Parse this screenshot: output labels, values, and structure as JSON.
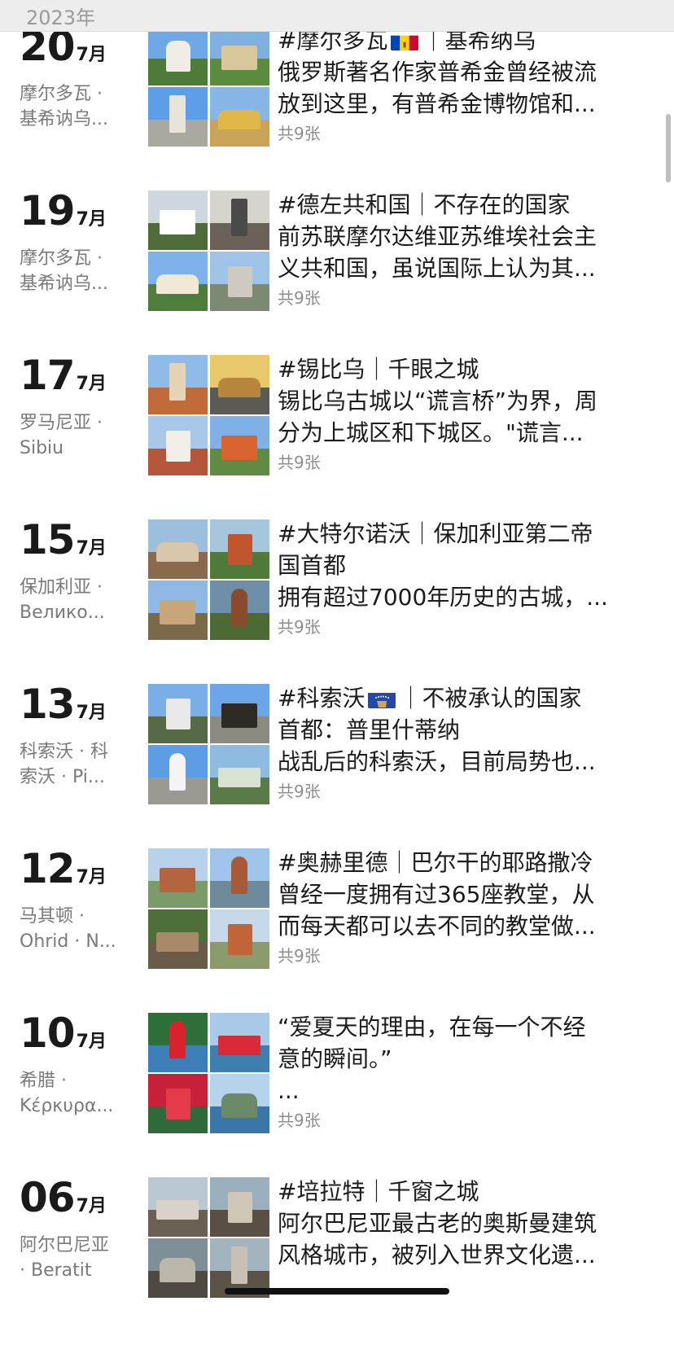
{
  "header": {
    "year": "2023年"
  },
  "entries": [
    {
      "day": "20",
      "month": "7月",
      "loc1": "摩尔多瓦 ·",
      "loc2": "基希讷乌...",
      "title": "#摩尔多瓦",
      "flag": "moldova",
      "title_after": "｜基希纳乌",
      "line2": "俄罗斯著名作家普希金曾经被流",
      "line3": "放到这里，有普希金博物馆和...",
      "count": "共9张",
      "photos": [
        {
          "sky": "#6fa8e6",
          "ground": "#4e7a3a",
          "obj": "#f0ede6"
        },
        {
          "sky": "#7fb0e0",
          "ground": "#5a8b3f",
          "obj": "#d8c79a"
        },
        {
          "sky": "#5d9ee8",
          "ground": "#a9a9a0",
          "obj": "#e8e4da"
        },
        {
          "sky": "#86b7e6",
          "ground": "#c9a35a",
          "obj": "#e0b84a"
        }
      ]
    },
    {
      "day": "19",
      "month": "7月",
      "loc1": "摩尔多瓦 ·",
      "loc2": "基希讷乌...",
      "title": "#德左共和国｜不存在的国家",
      "flag": "",
      "title_after": "",
      "line2": "前苏联摩尔达维亚苏维埃社会主",
      "line3": "义共和国，虽说国际上认为其...",
      "count": "共9张",
      "photos": [
        {
          "sky": "#cfd8df",
          "ground": "#4f6b3a",
          "obj": "#ffffff"
        },
        {
          "sky": "#d6d4cf",
          "ground": "#6a6258",
          "obj": "#4a4a48"
        },
        {
          "sky": "#7fb2ea",
          "ground": "#4f7d3b",
          "obj": "#efe9d6"
        },
        {
          "sky": "#9fc3e6",
          "ground": "#7c8a74",
          "obj": "#cfcac0"
        }
      ]
    },
    {
      "day": "17",
      "month": "7月",
      "loc1": "罗马尼亚 ·",
      "loc2": "Sibiu",
      "title": "#锡比乌｜千眼之城",
      "flag": "",
      "title_after": "",
      "line2": "锡比乌古城以“谎言桥”为界，周",
      "line3": "分为上城区和下城区。\"谎言...",
      "count": "共9张",
      "photos": [
        {
          "sky": "#8fbbe8",
          "ground": "#c06a3a",
          "obj": "#e6d4b6"
        },
        {
          "sky": "#e8c86a",
          "ground": "#5c5a55",
          "obj": "#b8873e"
        },
        {
          "sky": "#a8c8ea",
          "ground": "#b5553a",
          "obj": "#f2efe8"
        },
        {
          "sky": "#7fb0e6",
          "ground": "#5f8b42",
          "obj": "#d9642f"
        }
      ]
    },
    {
      "day": "15",
      "month": "7月",
      "loc1": "保加利亚 ·",
      "loc2": "Велико...",
      "title": "#大特尔诺沃｜保加利亚第二帝",
      "flag": "",
      "title_after": "",
      "line2": "国首都",
      "line3": "拥有超过7000年历史的古城，...",
      "count": "共9张",
      "photos": [
        {
          "sky": "#9bbfdc",
          "ground": "#8a6a4e",
          "obj": "#d8c7ac"
        },
        {
          "sky": "#a6c6de",
          "ground": "#4f7a3a",
          "obj": "#c0552f"
        },
        {
          "sky": "#8fb9e4",
          "ground": "#7a6a4a",
          "obj": "#c9a57a"
        },
        {
          "sky": "#6f8fa8",
          "ground": "#4c6a34",
          "obj": "#8a4a2e"
        }
      ]
    },
    {
      "day": "13",
      "month": "7月",
      "loc1": "科索沃 · 科",
      "loc2": "索沃 · Pi...",
      "title": "#科索沃",
      "flag": "kosovo",
      "title_after": "｜不被承认的国家",
      "line2": "首都：普里什蒂纳",
      "line3": "战乱后的科索沃，目前局势也...",
      "count": "共9张",
      "photos": [
        {
          "sky": "#7aaee6",
          "ground": "#566a48",
          "obj": "#e9e9e9"
        },
        {
          "sky": "#6ca6e8",
          "ground": "#8a8a80",
          "obj": "#2e2a24"
        },
        {
          "sky": "#5d9de6",
          "ground": "#9a9a92",
          "obj": "#f4f4f4"
        },
        {
          "sky": "#8ebbe0",
          "ground": "#5a7a48",
          "obj": "#d8e2d0"
        }
      ]
    },
    {
      "day": "12",
      "month": "7月",
      "loc1": "马其顿 ·",
      "loc2": "Ohrid · N...",
      "title": "#奥赫里德｜巴尔干的耶路撒冷",
      "flag": "",
      "title_after": "",
      "line2": "曾经一度拥有过365座教堂，从",
      "line3": "而每天都可以去不同的教堂做...",
      "count": "共9张",
      "photos": [
        {
          "sky": "#b7d2ea",
          "ground": "#7a9c6a",
          "obj": "#b4643e"
        },
        {
          "sky": "#9fc6ea",
          "ground": "#6d8b9a",
          "obj": "#a85a38"
        },
        {
          "sky": "#4e6e3a",
          "ground": "#6a5a48",
          "obj": "#a88a6a"
        },
        {
          "sky": "#c7d9e8",
          "ground": "#8a9a6a",
          "obj": "#c0653a"
        }
      ]
    },
    {
      "day": "10",
      "month": "7月",
      "loc1": "希腊 ·",
      "loc2": "Κέρκυρα...",
      "title": "“爱夏天的理由，在每一个不经",
      "flag": "",
      "title_after": "",
      "line2": "意的瞬间。”",
      "line3": "...",
      "count": "共9张",
      "photos": [
        {
          "sky": "#2f6f3a",
          "ground": "#3f7fb8",
          "obj": "#d8222e"
        },
        {
          "sky": "#a9cbe8",
          "ground": "#3e7fb0",
          "obj": "#d92a38"
        },
        {
          "sky": "#c8223a",
          "ground": "#2f6a3a",
          "obj": "#e43a4a"
        },
        {
          "sky": "#b6d3ec",
          "ground": "#3a77a8",
          "obj": "#6a8a6a"
        }
      ]
    },
    {
      "day": "06",
      "month": "7月",
      "loc1": "阿尔巴尼亚",
      "loc2": "· Beratit",
      "title": "#培拉特｜千窗之城",
      "flag": "",
      "title_after": "",
      "line2": "阿尔巴尼亚最古老的奥斯曼建筑",
      "line3": "风格城市，被列入世界文化遗...",
      "count": "",
      "photos": [
        {
          "sky": "#b9c8d2",
          "ground": "#6a6054",
          "obj": "#d8d2c8"
        },
        {
          "sky": "#9bb0bc",
          "ground": "#5a4f44",
          "obj": "#cfc6b8"
        },
        {
          "sky": "#7f8f98",
          "ground": "#4e4a42",
          "obj": "#bdb6aa"
        },
        {
          "sky": "#a4b4be",
          "ground": "#5c5348",
          "obj": "#c8c0b4"
        }
      ]
    }
  ]
}
